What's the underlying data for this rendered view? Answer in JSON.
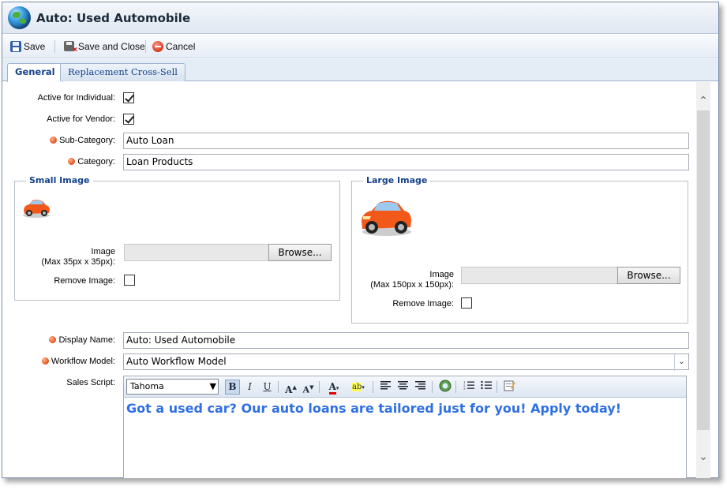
{
  "window": {
    "title": "Auto: Used Automobile"
  },
  "toolbar": {
    "save": "Save",
    "save_close": "Save and Close",
    "cancel": "Cancel"
  },
  "tabs": [
    {
      "label": "General",
      "active": true
    },
    {
      "label": "Replacement Cross-Sell",
      "active": false
    }
  ],
  "form": {
    "active_individual": {
      "label": "Active for Individual:",
      "checked": true
    },
    "active_vendor": {
      "label": "Active for Vendor:",
      "checked": true
    },
    "sub_category": {
      "label": "Sub-Category:",
      "value": "Auto Loan",
      "required": true
    },
    "category": {
      "label": "Category:",
      "value": "Loan Products",
      "required": true
    },
    "small_image": {
      "legend": "Small Image",
      "image_label": "Image",
      "size_note": "(Max 35px x 35px):",
      "browse": "Browse...",
      "remove_label": "Remove Image:",
      "remove_checked": false
    },
    "large_image": {
      "legend": "Large Image",
      "image_label": "Image",
      "size_note": "(Max 150px x 150px):",
      "browse": "Browse...",
      "remove_label": "Remove Image:",
      "remove_checked": false
    },
    "display_name": {
      "label": "Display Name:",
      "value": "Auto: Used Automobile",
      "required": true
    },
    "workflow_model": {
      "label": "Workflow Model:",
      "value": "Auto Workflow Model",
      "required": true
    },
    "sales_script": {
      "label": "Sales Script:",
      "font": "Tahoma",
      "content": "Got a used car? Our auto loans are tailored just for you! Apply today!",
      "text_color": "#2f6fe4"
    }
  },
  "colors": {
    "accent": "#15428b",
    "required_dot": "#e4501c"
  }
}
